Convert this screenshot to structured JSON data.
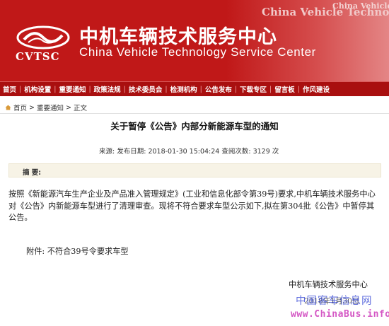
{
  "header": {
    "org_name_cn": "中机车辆技术服务中心",
    "org_name_en": "China Vehicle Technology Service Center",
    "logo_abbr": "CVTSC",
    "banner_faded_text": "China Vehicle Technolo",
    "banner_faded_text_small": "China Vehicle Technolo",
    "brand_color": "#c01818"
  },
  "nav": {
    "items": [
      "首页",
      "机构设置",
      "重要通知",
      "政策法规",
      "技术委员会",
      "检测机构",
      "公告发布",
      "下载专区",
      "留言板",
      "作风建设"
    ],
    "separator": "|"
  },
  "breadcrumb": {
    "icon": "home-icon",
    "items": [
      "首页",
      "重要通知",
      "正文"
    ],
    "separator": ">"
  },
  "article": {
    "title": "关于暂停《公告》内部分新能源车型的通知",
    "meta": "来源:   发布日期: 2018-01-30 15:04:24  查阅次数: 3129 次",
    "summary_label": "摘 要:",
    "body": "        按照《新能源汽车生产企业及产品准入管理规定》(工业和信息化部令第39号)要求,中机车辆技术服务中心对《公告》内新能源车型进行了清理审查。现将不符合要求车型公示如下,拟在第304批《公告》中暂停其公告。",
    "attachment": "附件: 不符合39号令要求车型",
    "signature_org": "中机车辆技术服务中心",
    "signature_date": "2018年1月30日"
  },
  "watermark": {
    "text_cn": "中国客车信息网",
    "url": "www.ChinaBus.info"
  }
}
